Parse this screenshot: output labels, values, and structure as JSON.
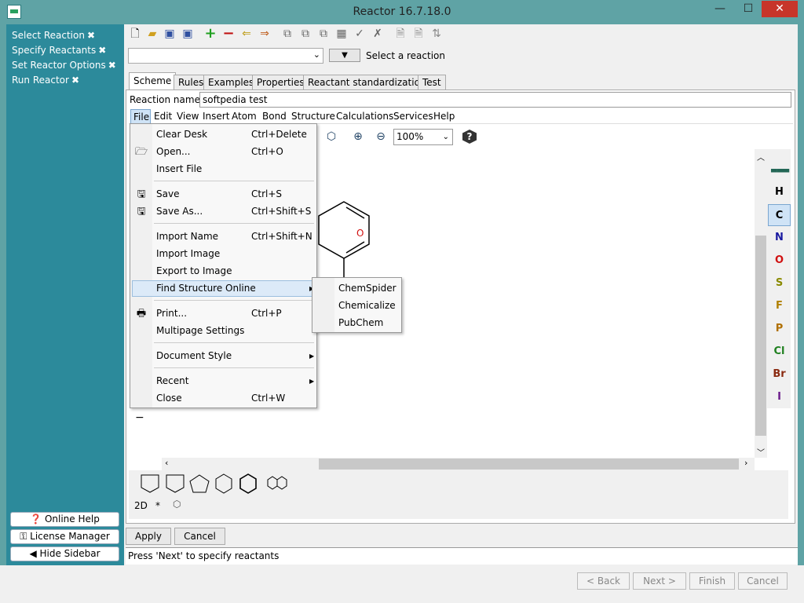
{
  "window": {
    "title": "Reactor 16.7.18.0",
    "min": "—",
    "max": "☐",
    "close": "✕"
  },
  "sidebar": {
    "items": [
      {
        "label": "Select Reaction",
        "x": "✖"
      },
      {
        "label": "Specify Reactants",
        "x": "✖"
      },
      {
        "label": "Set Reactor Options",
        "x": "✖"
      },
      {
        "label": "Run Reactor",
        "x": "✖"
      }
    ],
    "buttons": {
      "help": "Online Help",
      "license": "License Manager",
      "hide": "Hide Sidebar"
    }
  },
  "toolbar": {
    "select_reaction": "Select a reaction",
    "dropdown": "▼"
  },
  "tabs": [
    "Scheme",
    "Rules",
    "Examples",
    "Properties",
    "Reactant standardization",
    "Test"
  ],
  "reaction": {
    "label": "Reaction name:",
    "value": "softpedia test"
  },
  "menubar": [
    "File",
    "Edit",
    "View",
    "Insert",
    "Atom",
    "Bond",
    "Structure",
    "Calculations",
    "Services",
    "Help"
  ],
  "zoom": "100%",
  "file_menu": {
    "clear": "Clear Desk",
    "clear_sc": "Ctrl+Delete",
    "open": "Open...",
    "open_sc": "Ctrl+O",
    "insert": "Insert File",
    "save": "Save",
    "save_sc": "Ctrl+S",
    "saveas": "Save As...",
    "saveas_sc": "Ctrl+Shift+S",
    "import_name": "Import Name",
    "import_name_sc": "Ctrl+Shift+N",
    "import_image": "Import Image",
    "export": "Export to Image",
    "find": "Find Structure Online",
    "print": "Print...",
    "print_sc": "Ctrl+P",
    "multipage": "Multipage Settings",
    "docstyle": "Document Style",
    "recent": "Recent",
    "close": "Close",
    "close_sc": "Ctrl+W"
  },
  "submenu": [
    "ChemSpider",
    "Chemicalize",
    "PubChem"
  ],
  "elements": [
    {
      "s": "H",
      "c": "#000000"
    },
    {
      "s": "C",
      "c": "#000000"
    },
    {
      "s": "N",
      "c": "#1a1aa0"
    },
    {
      "s": "O",
      "c": "#d01010"
    },
    {
      "s": "S",
      "c": "#8a8a00"
    },
    {
      "s": "F",
      "c": "#b08000"
    },
    {
      "s": "P",
      "c": "#b07000"
    },
    {
      "s": "Cl",
      "c": "#208020"
    },
    {
      "s": "Br",
      "c": "#8a2a10"
    },
    {
      "s": "I",
      "c": "#6a1a8a"
    }
  ],
  "atom_label": "O",
  "bottom": {
    "mode": "2D",
    "star": "*"
  },
  "buttons": {
    "apply": "Apply",
    "cancel": "Cancel"
  },
  "status": "Press 'Next' to specify reactants",
  "footer": {
    "back": "< Back",
    "next": "Next >",
    "finish": "Finish",
    "cancel": "Cancel"
  }
}
